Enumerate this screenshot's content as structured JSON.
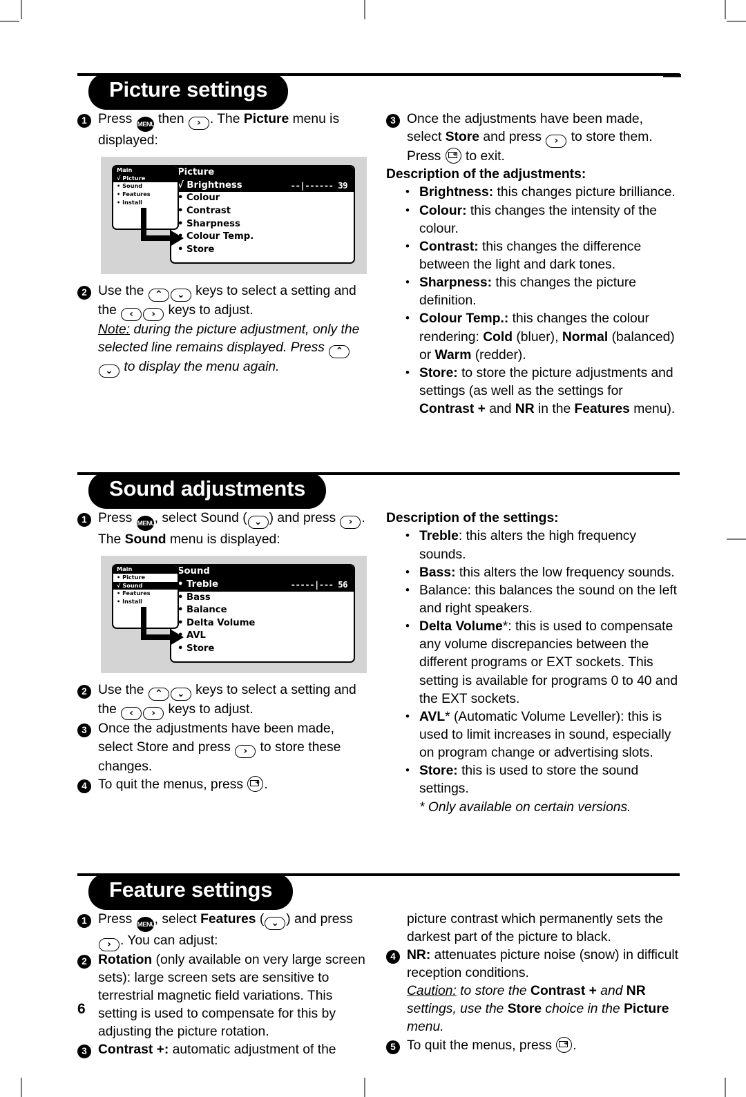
{
  "page": {
    "number": "6"
  },
  "sections": [
    {
      "id": "picture-settings",
      "title": "Picture settings",
      "left": {
        "step1": {
          "num": "1",
          "t1": "Press ",
          "key_menu": "MENU",
          "t2": " then ",
          "key_right": "›",
          "t3": ". The ",
          "b1": "Picture",
          "t4": " menu is displayed:"
        },
        "figure": {
          "main_title": "Main",
          "main_items": [
            {
              "mark": "√",
              "label": "Picture",
              "highlight": true
            },
            {
              "mark": "•",
              "label": "Sound",
              "highlight": false
            },
            {
              "mark": "•",
              "label": "Features",
              "highlight": false
            },
            {
              "mark": "•",
              "label": "Install",
              "highlight": false
            }
          ],
          "sub_title": "Picture",
          "sub_items": [
            {
              "mark": "√",
              "label": "Brightness",
              "value": "--|------ 39",
              "highlight": true
            },
            {
              "mark": "•",
              "label": "Colour",
              "value": "",
              "highlight": false
            },
            {
              "mark": "•",
              "label": "Contrast",
              "value": "",
              "highlight": false
            },
            {
              "mark": "•",
              "label": "Sharpness",
              "value": "",
              "highlight": false
            },
            {
              "mark": "•",
              "label": "Colour Temp.",
              "value": "",
              "highlight": false
            },
            {
              "mark": "•",
              "label": "Store",
              "value": "",
              "highlight": false
            }
          ]
        },
        "step2": {
          "num": "2",
          "t1": "Use the ",
          "key_up": "⌃",
          "key_down": "⌄",
          "t2": " keys to select a setting and the ",
          "key_left": "‹",
          "key_right": "›",
          "t3": " keys to adjust.",
          "note_label": "Note:",
          "note_a": " during the picture adjustment, only the selected line remains displayed. Press ",
          "note_b": " to display the menu again."
        }
      },
      "right": {
        "step3": {
          "num": "3",
          "t1": "Once the adjustments have been made, select ",
          "b1": "Store",
          "t2": " and press ",
          "key_right": "›",
          "t3": " to store them. Press ",
          "t4": " to exit."
        },
        "desc_heading": "Description of the adjustments:",
        "items": [
          {
            "term": "Brightness:",
            "text": " this changes picture brilliance."
          },
          {
            "term": "Colour:",
            "text": " this changes the intensity of the colour."
          },
          {
            "term": "Contrast:",
            "text": " this changes the difference between the light and dark tones."
          },
          {
            "term": "Sharpness:",
            "text": " this changes the picture definition."
          },
          {
            "term": "Colour Temp.:",
            "text": " this changes the colour rendering: ",
            "parts": [
              {
                "b": "Cold",
                "p": " (bluer), "
              },
              {
                "b": "Normal",
                "p": " (balanced) or "
              },
              {
                "b": "Warm",
                "p": " (redder)."
              }
            ]
          },
          {
            "term": "Store:",
            "text": " to store the picture adjustments and settings (as well as the settings for ",
            "parts": [
              {
                "b": "Contrast +",
                "p": " and "
              },
              {
                "b": "NR",
                "p": " in the "
              },
              {
                "b": "Features",
                "p": " menu)."
              }
            ]
          }
        ]
      }
    },
    {
      "id": "sound-adjustments",
      "title": "Sound adjustments",
      "left": {
        "step1": {
          "num": "1",
          "t1": "Press ",
          "key_menu": "MENU",
          "t2": ", select Sound (",
          "key_down": "⌄",
          "t3": ") and press ",
          "key_right": "›",
          "t4": ". The ",
          "b1": "Sound",
          "t5": " menu is displayed:"
        },
        "figure": {
          "main_title": "Main",
          "main_items": [
            {
              "mark": "•",
              "label": "Picture",
              "highlight": false
            },
            {
              "mark": "√",
              "label": "Sound",
              "highlight": true
            },
            {
              "mark": "•",
              "label": "Features",
              "highlight": false
            },
            {
              "mark": "•",
              "label": "Install",
              "highlight": false
            }
          ],
          "sub_title": "Sound",
          "sub_items": [
            {
              "mark": "•",
              "label": "Treble",
              "value": "-----|--- 56",
              "highlight": true
            },
            {
              "mark": "•",
              "label": "Bass",
              "value": "",
              "highlight": false
            },
            {
              "mark": "•",
              "label": "Balance",
              "value": "",
              "highlight": false
            },
            {
              "mark": "•",
              "label": "Delta Volume",
              "value": "",
              "highlight": false
            },
            {
              "mark": "•",
              "label": "AVL",
              "value": "",
              "highlight": false
            },
            {
              "mark": "•",
              "label": "Store",
              "value": "",
              "highlight": false
            }
          ]
        },
        "step2": {
          "num": "2",
          "t1": "Use the ",
          "t2": " keys to select a setting and the ",
          "t3": " keys to adjust."
        },
        "step3": {
          "num": "3",
          "t1": "Once the adjustments have been made, select Store and press ",
          "t2": " to store these changes."
        },
        "step4": {
          "num": "4",
          "t1": "To quit the menus, press ",
          "t2": "."
        }
      },
      "right": {
        "desc_heading": "Description of the settings:",
        "items": [
          {
            "term": "Treble",
            "sep": ":",
            "text": " this alters the high frequency sounds."
          },
          {
            "term": "Bass:",
            "sep": "",
            "text": " this alters the low frequency sounds."
          },
          {
            "term": "",
            "sep": "",
            "text": "Balance: this balances the sound on the left and right speakers."
          },
          {
            "term": "Delta Volume",
            "sep": "*:",
            "text": " this is used to compensate any volume discrepancies between the different programs or EXT sockets. This setting is available for programs 0 to 40 and the EXT sockets."
          },
          {
            "term": "AVL",
            "sep": "*",
            "text": " (Automatic Volume Leveller): this is used to limit increases in sound, especially on program change or advertising slots."
          },
          {
            "term": "Store:",
            "sep": "",
            "text": " this is used to store the sound settings."
          }
        ],
        "footnote": "* Only available on certain versions."
      }
    },
    {
      "id": "feature-settings",
      "title": "Feature settings",
      "left": {
        "step1": {
          "num": "1",
          "t1": "Press ",
          "t2": ", select ",
          "b1": "Features",
          "t3": " (",
          "t4": ") and press ",
          "t5": ". You can adjust:"
        },
        "step2": {
          "num": "2",
          "b1": "Rotation",
          "t1": " (only available on very large screen sets): large screen sets are sensitive to terrestrial magnetic field variations. This setting is used to compensate for this by adjusting the picture rotation."
        },
        "step3": {
          "num": "3",
          "b1": "Contrast +:",
          "t1": " automatic adjustment of the"
        }
      },
      "right": {
        "cont": "picture contrast which permanently sets the darkest part of the picture to black.",
        "step4": {
          "num": "4",
          "b1": "NR:",
          "t1": " attenuates picture noise (snow) in difficult reception conditions.",
          "caution_label": "Caution:",
          "caution_a": " to store the ",
          "caution_b1": "Contrast +",
          "caution_c": " and ",
          "caution_b2": "NR",
          "caution_d": " settings, use the ",
          "caution_b3": "Store",
          "caution_e": " choice in the ",
          "caution_b4": "Picture",
          "caution_f": " menu."
        },
        "step5": {
          "num": "5",
          "t1": "To quit the menus, press ",
          "t2": "."
        }
      }
    }
  ]
}
